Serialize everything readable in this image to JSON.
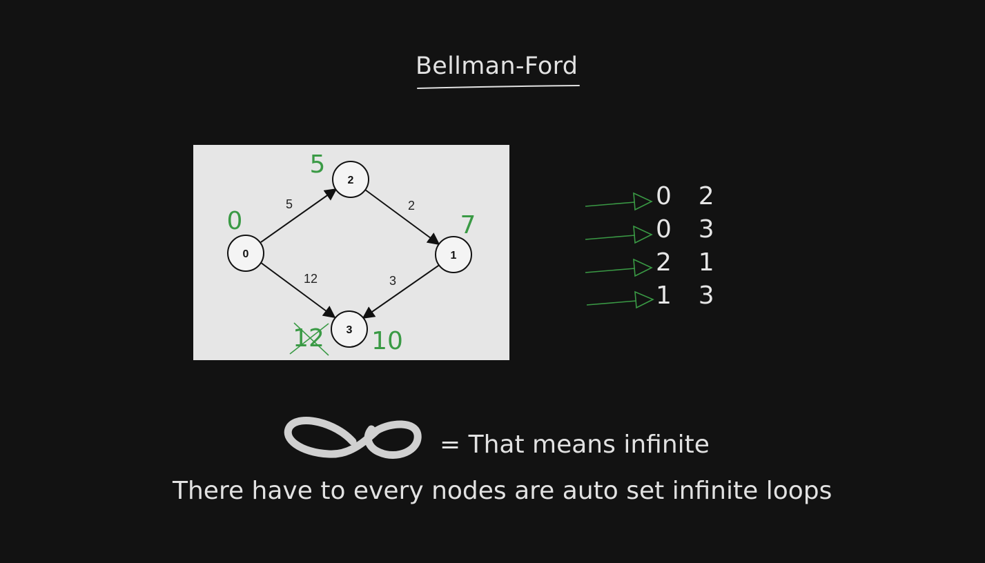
{
  "title": "Bellman-Ford",
  "graph": {
    "nodes": [
      {
        "id": "0",
        "label": "0",
        "distance": "0"
      },
      {
        "id": "2",
        "label": "2",
        "distance": "5"
      },
      {
        "id": "1",
        "label": "1",
        "distance": "7"
      },
      {
        "id": "3",
        "label": "3",
        "distance_crossed": "12",
        "distance": "10"
      }
    ],
    "edges": [
      {
        "from": "0",
        "to": "2",
        "weight": "5"
      },
      {
        "from": "2",
        "to": "1",
        "weight": "2"
      },
      {
        "from": "0",
        "to": "3",
        "weight": "12"
      },
      {
        "from": "1",
        "to": "3",
        "weight": "3"
      }
    ]
  },
  "edge_list": [
    {
      "text": "0  2"
    },
    {
      "text": "0  3"
    },
    {
      "text": "2  1"
    },
    {
      "text": "1  3"
    }
  ],
  "infinity_caption": "= That means infinite",
  "note": "There have to every nodes are auto set infinite loops",
  "colors": {
    "background": "#121212",
    "annotation_green": "#3a9a45",
    "panel": "#e6e6e6",
    "text": "#e2e2e2"
  }
}
